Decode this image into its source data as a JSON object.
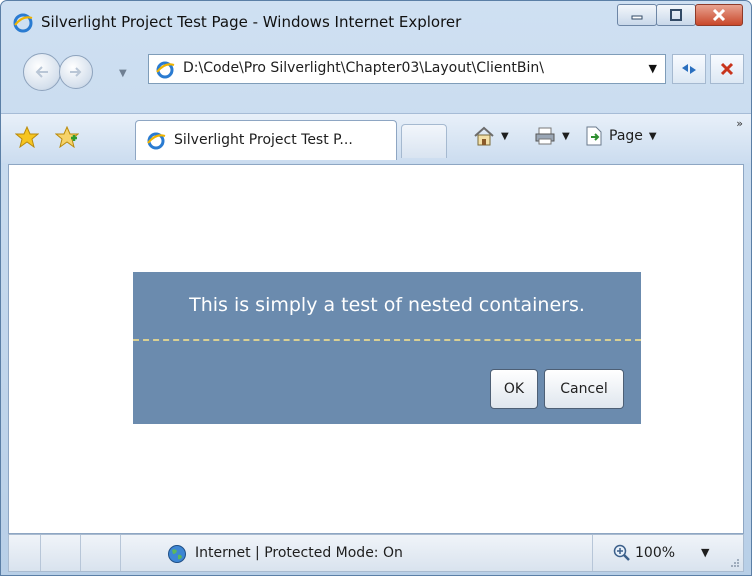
{
  "window": {
    "title": "Silverlight Project Test Page - Windows Internet Explorer"
  },
  "address_bar": {
    "url": "D:\\Code\\Pro Silverlight\\Chapter03\\Layout\\ClientBin\\"
  },
  "tab": {
    "label": "Silverlight Project Test P..."
  },
  "command_bar": {
    "page_label": "Page"
  },
  "content": {
    "message": "This is simply a test of nested containers.",
    "ok_label": "OK",
    "cancel_label": "Cancel",
    "panel_color": "#6b8bae"
  },
  "status_bar": {
    "zone_text": "Internet | Protected Mode: On",
    "zoom": "100%"
  }
}
